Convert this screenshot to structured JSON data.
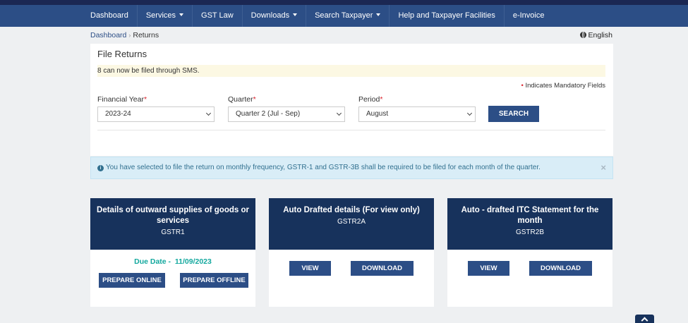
{
  "nav": [
    {
      "label": "Dashboard",
      "dropdown": false
    },
    {
      "label": "Services",
      "dropdown": true
    },
    {
      "label": "GST Law",
      "dropdown": false
    },
    {
      "label": "Downloads",
      "dropdown": true
    },
    {
      "label": "Search Taxpayer",
      "dropdown": true
    },
    {
      "label": "Help and Taxpayer Facilities",
      "dropdown": false
    },
    {
      "label": "e-Invoice",
      "dropdown": false
    }
  ],
  "breadcrumb": {
    "home": "Dashboard",
    "separator": "›",
    "current": "Returns"
  },
  "language": "English",
  "panel": {
    "title": "File Returns",
    "sms_notice": "8 can now be filed through SMS.",
    "mandatory_note": "Indicates Mandatory Fields",
    "fields": {
      "financial_year": {
        "label": "Financial Year",
        "value": "2023-24"
      },
      "quarter": {
        "label": "Quarter",
        "value": "Quarter 2 (Jul - Sep)"
      },
      "period": {
        "label": "Period",
        "value": "August"
      }
    },
    "search_label": "SEARCH"
  },
  "info_message": "You have selected to file the return on monthly frequency, GSTR-1 and GSTR-3B shall be required to be filed for each month of the quarter.",
  "cards": [
    {
      "title": "Details of outward supplies of goods or services",
      "code": "GSTR1",
      "due_label": "Due Date -",
      "due_date": "11/09/2023",
      "buttons": [
        "PREPARE ONLINE",
        "PREPARE OFFLINE"
      ]
    },
    {
      "title": "Auto Drafted details (For view only)",
      "code": "GSTR2A",
      "buttons": [
        "VIEW",
        "DOWNLOAD"
      ]
    },
    {
      "title": "Auto - drafted ITC Statement for the month",
      "code": "GSTR2B",
      "buttons": [
        "VIEW",
        "DOWNLOAD"
      ]
    }
  ],
  "colors": {
    "nav": "#2c4e86",
    "card_header": "#17325c",
    "due_date": "#13a89e",
    "info_bg": "#d9edf7"
  }
}
